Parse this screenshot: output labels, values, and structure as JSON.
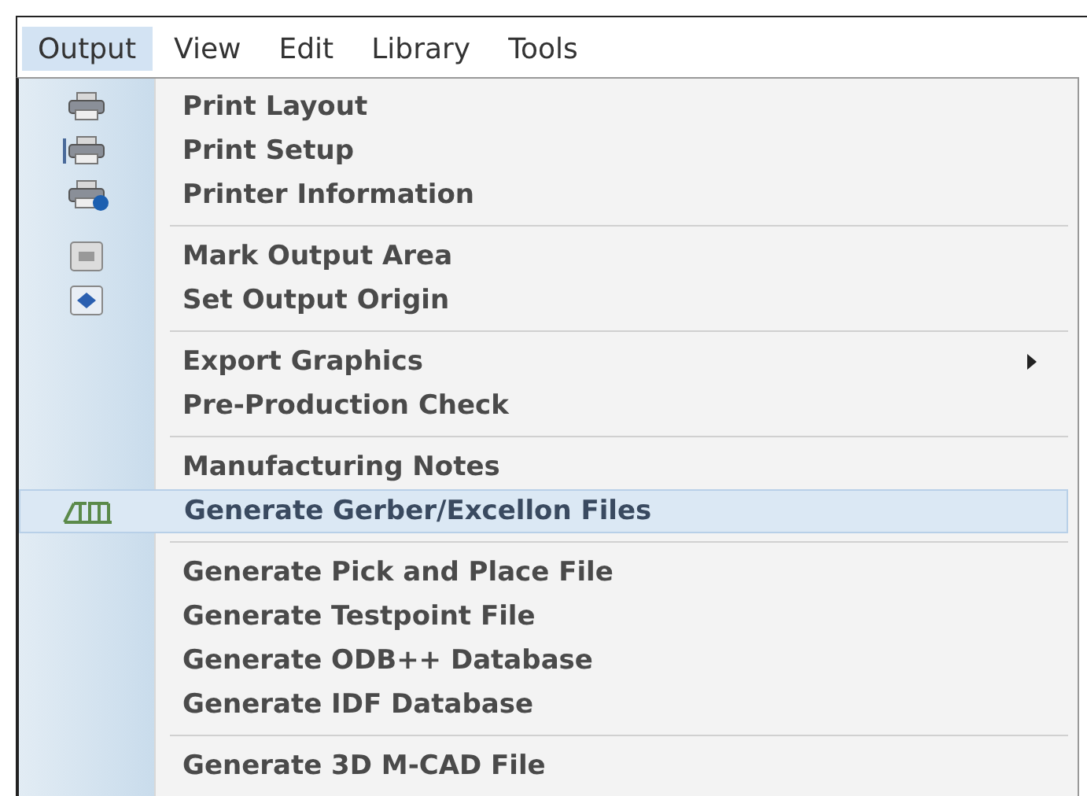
{
  "menubar": [
    {
      "label": "Output",
      "selected": true
    },
    {
      "label": "View",
      "selected": false
    },
    {
      "label": "Edit",
      "selected": false
    },
    {
      "label": "Library",
      "selected": false
    },
    {
      "label": "Tools",
      "selected": false
    }
  ],
  "menu": [
    {
      "kind": "item",
      "label": "Print Layout",
      "submenu": false,
      "selected": false
    },
    {
      "kind": "item",
      "label": "Print Setup",
      "submenu": false,
      "selected": false
    },
    {
      "kind": "item",
      "label": "Printer Information",
      "submenu": false,
      "selected": false
    },
    {
      "kind": "separator"
    },
    {
      "kind": "item",
      "label": "Mark Output Area",
      "submenu": false,
      "selected": false
    },
    {
      "kind": "item",
      "label": "Set Output Origin",
      "submenu": false,
      "selected": false
    },
    {
      "kind": "separator"
    },
    {
      "kind": "item",
      "label": "Export Graphics",
      "submenu": true,
      "selected": false
    },
    {
      "kind": "item",
      "label": "Pre-Production Check",
      "submenu": false,
      "selected": false
    },
    {
      "kind": "separator"
    },
    {
      "kind": "item",
      "label": "Manufacturing Notes",
      "submenu": false,
      "selected": false
    },
    {
      "kind": "item",
      "label": "Generate Gerber/Excellon Files",
      "submenu": false,
      "selected": true
    },
    {
      "kind": "separator"
    },
    {
      "kind": "item",
      "label": "Generate Pick and Place File",
      "submenu": false,
      "selected": false
    },
    {
      "kind": "item",
      "label": "Generate Testpoint File",
      "submenu": false,
      "selected": false
    },
    {
      "kind": "item",
      "label": "Generate ODB++ Database",
      "submenu": false,
      "selected": false
    },
    {
      "kind": "item",
      "label": "Generate IDF Database",
      "submenu": false,
      "selected": false
    },
    {
      "kind": "separator"
    },
    {
      "kind": "item",
      "label": "Generate 3D M-CAD File",
      "submenu": false,
      "selected": false
    }
  ]
}
